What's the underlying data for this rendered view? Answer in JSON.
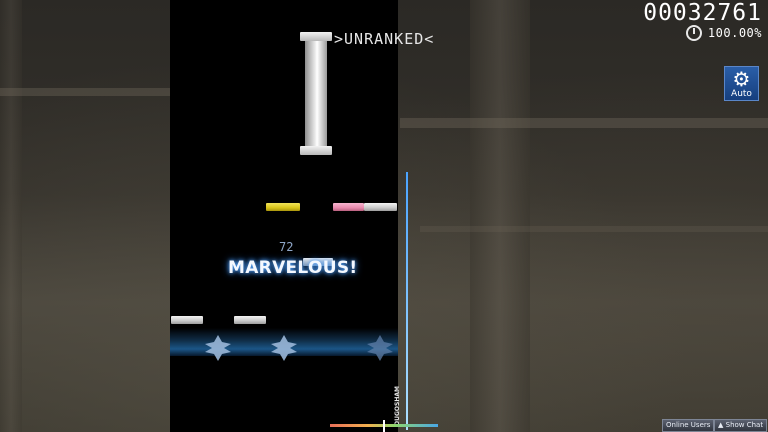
{
  "game": {
    "unranked_label": ">UNRANKED<",
    "combo": "72",
    "judgement": "MARVELOUS!",
    "score": "00032761",
    "accuracy": "100.00%",
    "hp_label": "OUGOSHAM",
    "auto_button_label": "Auto",
    "auto_icon": "gear-icon",
    "timer_icon": "clock-icon"
  },
  "bottom_bar": {
    "online_users": "Online Users",
    "show_chat": "Show Chat",
    "show_chat_icon": "chevron-up-icon"
  },
  "colors": {
    "note_white": "#d8d8d8",
    "note_yellow": "#e0cc1e",
    "note_pink": "#ec93b5",
    "judgement_glow": "#2c7be0",
    "auto_button": "#1f4f96"
  }
}
